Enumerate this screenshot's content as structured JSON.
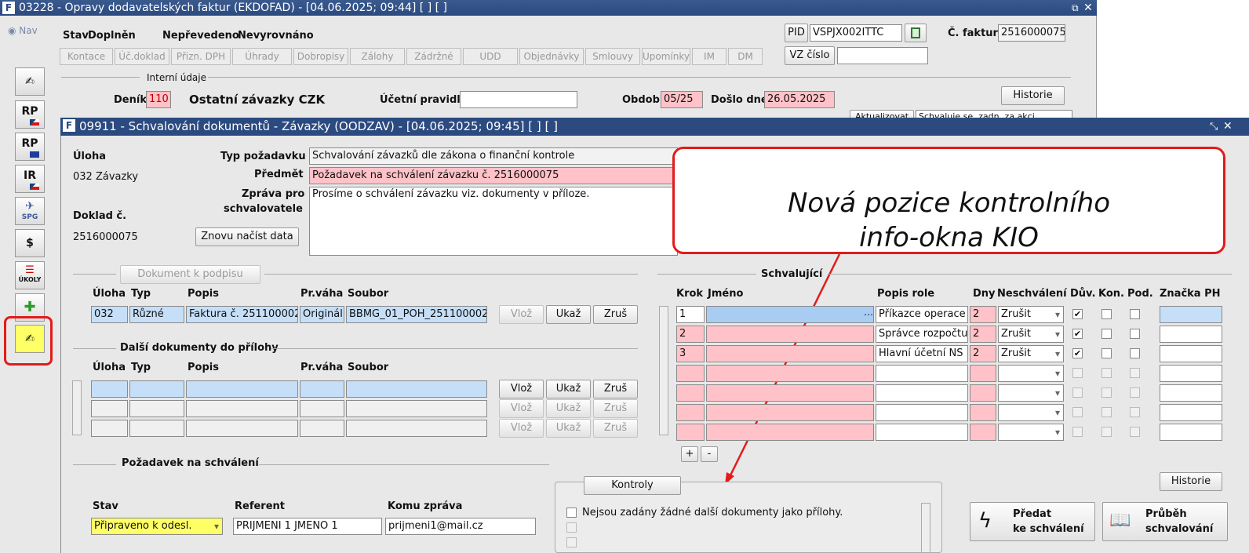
{
  "outer": {
    "title": "03228 - Opravy dodavatelských faktur (EKDOFAD) - [04.06.2025; 09:44]  [ ]  [ ]",
    "nav": "Nav",
    "stav_label": "Stav",
    "stav_value": "Doplněn",
    "neprevedeno": "Nepřevedeno",
    "nevyrovnano": "Nevyrovnáno",
    "tabs": [
      "Kontace",
      "Úč.doklad",
      "Přizn. DPH",
      "Úhrady",
      "Dobropisy",
      "Zálohy",
      "Zádržné",
      "UDD",
      "Objednávky",
      "Smlouvy",
      "Upomínky",
      "IM",
      "DM"
    ],
    "pid_label": "PID",
    "pid_value": "VSPJX002ITTC",
    "cfaktury_label": "Č. faktury",
    "cfaktury_value": "2516000075",
    "vz_label": "VZ číslo",
    "vz_value": "",
    "interni_udaje": "Interní údaje",
    "denik_label": "Deník",
    "denik_value": "110",
    "ostatni": "Ostatní závazky CZK",
    "ucetni_label": "Účetní pravidlo",
    "ucetni_value": "",
    "obdobi_label": "Období",
    "obdobi_value": "05/25",
    "doslo_label": "Došlo dne",
    "doslo_value": "26.05.2025",
    "historie": "Historie",
    "aktualizovat": "Aktualizovat",
    "schvaluje_value": "Schvaluje se, zadn. za akci"
  },
  "sidebar": {
    "rp1": "RP",
    "rp2": "RP",
    "ir": "IR",
    "spg": "SPG",
    "ukoly": "ÚKOLY"
  },
  "inner": {
    "title": "09911 - Schvalování dokumentů - Závazky (OODZAV) - [04.06.2025; 09:45]  [ ]  [ ]",
    "uloha_label": "Úloha",
    "uloha_value": "032 Závazky",
    "doklad_label": "Doklad č.",
    "doklad_value": "2516000075",
    "znovu": "Znovu načíst data",
    "typ_label": "Typ požadavku",
    "typ_value": "Schvalování závazků dle zákona o finanční kontrole",
    "predmet_label": "Předmět",
    "predmet_value": "Požadavek na schválení závazku č. 2516000075",
    "zprava_label1": "Zpráva pro",
    "zprava_label2": "schvalovatele",
    "zprava_value": "Prosíme o schválení závazku viz. dokumenty v příloze.",
    "dokument_k_podpisu": "Dokument k podpisu",
    "doc_headers": [
      "Úloha",
      "Typ",
      "Popis",
      "Pr.váha",
      "Soubor"
    ],
    "doc_row": [
      "032",
      "Různé",
      "Faktura č. 251100002",
      "Originál",
      "BBMG_01_POH_251100002"
    ],
    "vloz": "Vlož",
    "ukaz": "Ukaž",
    "zrus": "Zruš",
    "dalsi": "Další dokumenty do přílohy",
    "schvalujici": "Schvalující",
    "appr_headers": [
      "Krok",
      "Jméno",
      "Popis role",
      "Dny",
      "Neschválení",
      "Dův.",
      "Kon.",
      "Pod.",
      "Značka PH"
    ],
    "appr_rows": [
      {
        "krok": "1",
        "role": "Příkazce operace I",
        "dny": "2",
        "neschvaleni": "Zrušit"
      },
      {
        "krok": "2",
        "role": "Správce rozpočtu",
        "dny": "2",
        "neschvaleni": "Zrušit"
      },
      {
        "krok": "3",
        "role": "Hlavní účetní NS",
        "dny": "2",
        "neschvaleni": "Zrušit"
      }
    ],
    "plus": "+",
    "minus": "-",
    "pozadavek": "Požadavek na schválení",
    "stav_label": "Stav",
    "stav_value": "Připraveno k odesl.",
    "referent_label": "Referent",
    "referent_value": "PRIJMENI 1 JMENO 1",
    "komu_label": "Komu zpráva",
    "komu_value": "prijmeni1@mail.cz",
    "kontroly": "Kontroly",
    "kontroly_msg": "Nejsou zadány žádné další dokumenty jako přílohy.",
    "historie": "Historie",
    "predat1": "Předat",
    "predat2": "ke schválení",
    "prubeh1": "Průběh",
    "prubeh2": "schvalování"
  },
  "annotation": {
    "line1": "Nová pozice kontrolního",
    "line2": "info-okna KIO",
    "color": "#e21b1b"
  }
}
